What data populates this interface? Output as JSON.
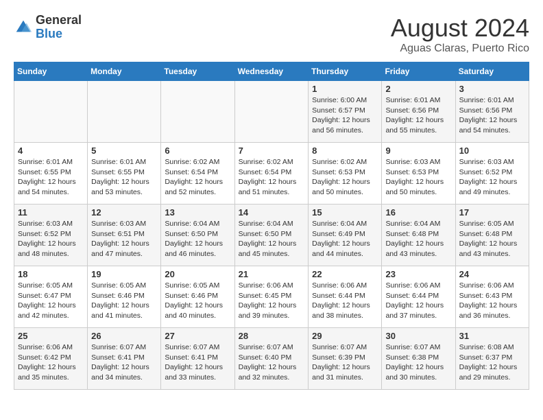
{
  "header": {
    "logo_line1": "General",
    "logo_line2": "Blue",
    "month": "August 2024",
    "location": "Aguas Claras, Puerto Rico"
  },
  "days_of_week": [
    "Sunday",
    "Monday",
    "Tuesday",
    "Wednesday",
    "Thursday",
    "Friday",
    "Saturday"
  ],
  "weeks": [
    [
      {
        "day": "",
        "info": ""
      },
      {
        "day": "",
        "info": ""
      },
      {
        "day": "",
        "info": ""
      },
      {
        "day": "",
        "info": ""
      },
      {
        "day": "1",
        "info": "Sunrise: 6:00 AM\nSunset: 6:57 PM\nDaylight: 12 hours\nand 56 minutes."
      },
      {
        "day": "2",
        "info": "Sunrise: 6:01 AM\nSunset: 6:56 PM\nDaylight: 12 hours\nand 55 minutes."
      },
      {
        "day": "3",
        "info": "Sunrise: 6:01 AM\nSunset: 6:56 PM\nDaylight: 12 hours\nand 54 minutes."
      }
    ],
    [
      {
        "day": "4",
        "info": "Sunrise: 6:01 AM\nSunset: 6:55 PM\nDaylight: 12 hours\nand 54 minutes."
      },
      {
        "day": "5",
        "info": "Sunrise: 6:01 AM\nSunset: 6:55 PM\nDaylight: 12 hours\nand 53 minutes."
      },
      {
        "day": "6",
        "info": "Sunrise: 6:02 AM\nSunset: 6:54 PM\nDaylight: 12 hours\nand 52 minutes."
      },
      {
        "day": "7",
        "info": "Sunrise: 6:02 AM\nSunset: 6:54 PM\nDaylight: 12 hours\nand 51 minutes."
      },
      {
        "day": "8",
        "info": "Sunrise: 6:02 AM\nSunset: 6:53 PM\nDaylight: 12 hours\nand 50 minutes."
      },
      {
        "day": "9",
        "info": "Sunrise: 6:03 AM\nSunset: 6:53 PM\nDaylight: 12 hours\nand 50 minutes."
      },
      {
        "day": "10",
        "info": "Sunrise: 6:03 AM\nSunset: 6:52 PM\nDaylight: 12 hours\nand 49 minutes."
      }
    ],
    [
      {
        "day": "11",
        "info": "Sunrise: 6:03 AM\nSunset: 6:52 PM\nDaylight: 12 hours\nand 48 minutes."
      },
      {
        "day": "12",
        "info": "Sunrise: 6:03 AM\nSunset: 6:51 PM\nDaylight: 12 hours\nand 47 minutes."
      },
      {
        "day": "13",
        "info": "Sunrise: 6:04 AM\nSunset: 6:50 PM\nDaylight: 12 hours\nand 46 minutes."
      },
      {
        "day": "14",
        "info": "Sunrise: 6:04 AM\nSunset: 6:50 PM\nDaylight: 12 hours\nand 45 minutes."
      },
      {
        "day": "15",
        "info": "Sunrise: 6:04 AM\nSunset: 6:49 PM\nDaylight: 12 hours\nand 44 minutes."
      },
      {
        "day": "16",
        "info": "Sunrise: 6:04 AM\nSunset: 6:48 PM\nDaylight: 12 hours\nand 43 minutes."
      },
      {
        "day": "17",
        "info": "Sunrise: 6:05 AM\nSunset: 6:48 PM\nDaylight: 12 hours\nand 43 minutes."
      }
    ],
    [
      {
        "day": "18",
        "info": "Sunrise: 6:05 AM\nSunset: 6:47 PM\nDaylight: 12 hours\nand 42 minutes."
      },
      {
        "day": "19",
        "info": "Sunrise: 6:05 AM\nSunset: 6:46 PM\nDaylight: 12 hours\nand 41 minutes."
      },
      {
        "day": "20",
        "info": "Sunrise: 6:05 AM\nSunset: 6:46 PM\nDaylight: 12 hours\nand 40 minutes."
      },
      {
        "day": "21",
        "info": "Sunrise: 6:06 AM\nSunset: 6:45 PM\nDaylight: 12 hours\nand 39 minutes."
      },
      {
        "day": "22",
        "info": "Sunrise: 6:06 AM\nSunset: 6:44 PM\nDaylight: 12 hours\nand 38 minutes."
      },
      {
        "day": "23",
        "info": "Sunrise: 6:06 AM\nSunset: 6:44 PM\nDaylight: 12 hours\nand 37 minutes."
      },
      {
        "day": "24",
        "info": "Sunrise: 6:06 AM\nSunset: 6:43 PM\nDaylight: 12 hours\nand 36 minutes."
      }
    ],
    [
      {
        "day": "25",
        "info": "Sunrise: 6:06 AM\nSunset: 6:42 PM\nDaylight: 12 hours\nand 35 minutes."
      },
      {
        "day": "26",
        "info": "Sunrise: 6:07 AM\nSunset: 6:41 PM\nDaylight: 12 hours\nand 34 minutes."
      },
      {
        "day": "27",
        "info": "Sunrise: 6:07 AM\nSunset: 6:41 PM\nDaylight: 12 hours\nand 33 minutes."
      },
      {
        "day": "28",
        "info": "Sunrise: 6:07 AM\nSunset: 6:40 PM\nDaylight: 12 hours\nand 32 minutes."
      },
      {
        "day": "29",
        "info": "Sunrise: 6:07 AM\nSunset: 6:39 PM\nDaylight: 12 hours\nand 31 minutes."
      },
      {
        "day": "30",
        "info": "Sunrise: 6:07 AM\nSunset: 6:38 PM\nDaylight: 12 hours\nand 30 minutes."
      },
      {
        "day": "31",
        "info": "Sunrise: 6:08 AM\nSunset: 6:37 PM\nDaylight: 12 hours\nand 29 minutes."
      }
    ]
  ]
}
